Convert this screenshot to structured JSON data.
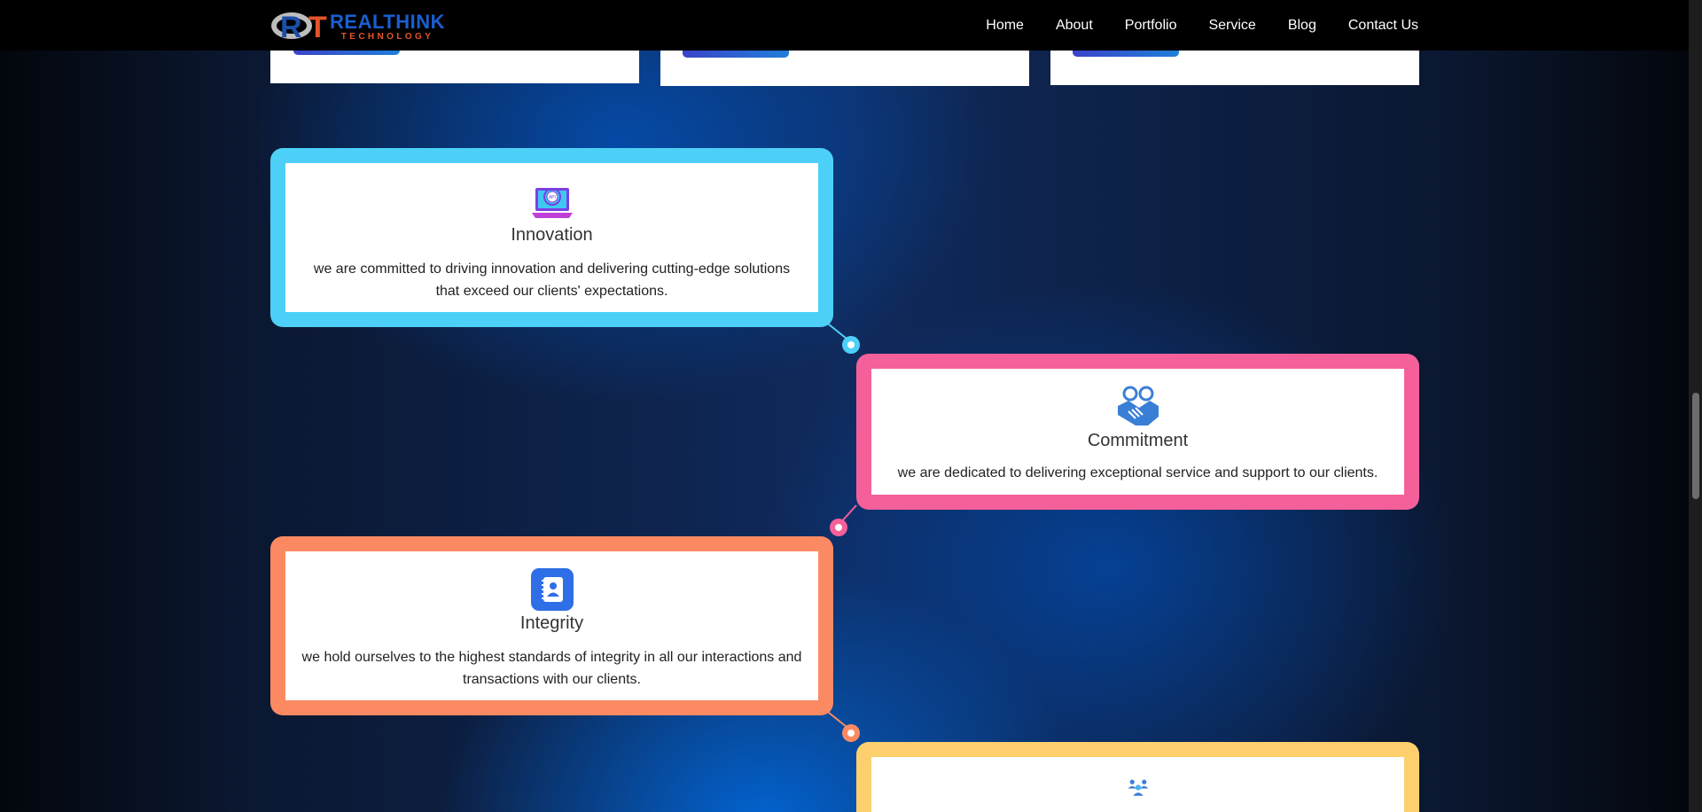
{
  "nav": {
    "logo": {
      "mark_letters": "RT",
      "brand": "REALTHINK",
      "sub": "TECHNOLOGY"
    },
    "links": [
      "Home",
      "About",
      "Portfolio",
      "Service",
      "Blog",
      "Contact Us"
    ]
  },
  "timeline": [
    {
      "title": "Innovation",
      "description": "we are committed to driving innovation and delivering cutting-edge solutions that exceed our clients' expectations.",
      "icon": "laptop-api-gear-icon",
      "color": "#4dd0f7"
    },
    {
      "title": "Commitment",
      "description": "we are dedicated to delivering exceptional service and support to our clients.",
      "icon": "handshake-icon",
      "color": "#f5609a"
    },
    {
      "title": "Integrity",
      "description": "we hold ourselves to the highest standards of integrity in all our interactions and transactions with our clients.",
      "icon": "contact-book-icon",
      "color": "#fb8a63"
    },
    {
      "title": "",
      "description": "",
      "icon": "team-icon",
      "color": "#fdd06d"
    }
  ],
  "colors": {
    "nav_bg": "#000000",
    "accent_blue": "#1a5fd0",
    "accent_orange": "#e5542a"
  }
}
